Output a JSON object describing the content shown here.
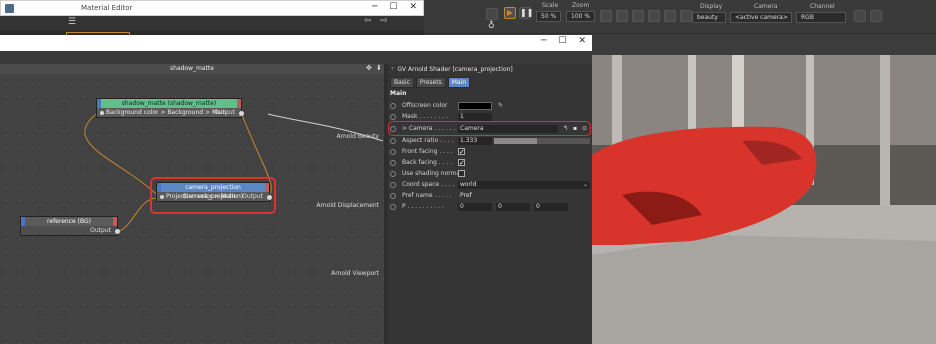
{
  "material_editor": {
    "title": "Material Editor"
  },
  "render_toolbar": {
    "scale_label": "Scale",
    "scale_value": "50 %",
    "zoom_label": "Zoom",
    "zoom_value": "100 %",
    "display_label": "Display",
    "display_value": "beauty",
    "camera_label": "Camera",
    "camera_value": "<active camera>",
    "channel_label": "Channel",
    "channel_value": "RGB"
  },
  "graph": {
    "title": "shadow_matte",
    "nodes": [
      {
        "title": "shadow_matte (shadow_matte)",
        "input": "Background color > Background > Main",
        "output": "Output",
        "color": "#5fc08c"
      },
      {
        "title": "camera_projection (camera_projection)",
        "input": "Projection color > Main",
        "output": "Output",
        "color": "#5b87c4"
      },
      {
        "title": "reference (BG)",
        "output": "Output",
        "color": "#5b5b5b"
      }
    ],
    "root_ports": [
      "Arnold Beauty",
      "Arnold Displacement",
      "Arnold Viewport"
    ]
  },
  "attributes": {
    "header": "GV Arnold Shader [camera_projection]",
    "tabs": [
      "Basic",
      "Presets",
      "Main"
    ],
    "active_tab": "Main",
    "section": "Main",
    "rows": [
      {
        "label": "Offscreen color",
        "value": ""
      },
      {
        "label": "Mask . . . . . . . .",
        "value": "1"
      },
      {
        "label": "> Camera . . . . . .",
        "value": "Camera"
      },
      {
        "label": "Aspect ratio . . . .",
        "value": "1.333"
      },
      {
        "label": "Front facing . . . .",
        "value": "checked"
      },
      {
        "label": "Back facing . . . .",
        "value": "checked"
      },
      {
        "label": "Use shading normal",
        "value": "unchecked"
      },
      {
        "label": "Coord space . . . .",
        "value": "world"
      },
      {
        "label": "Pref name . . . . .",
        "value": "Pref"
      },
      {
        "label": "P . . . . . . . . . .",
        "value": [
          "0",
          "0",
          "0"
        ]
      }
    ]
  },
  "colors": {
    "highlight": "#d9342b",
    "wire": "#c7862b",
    "accent": "#5b87c4"
  }
}
